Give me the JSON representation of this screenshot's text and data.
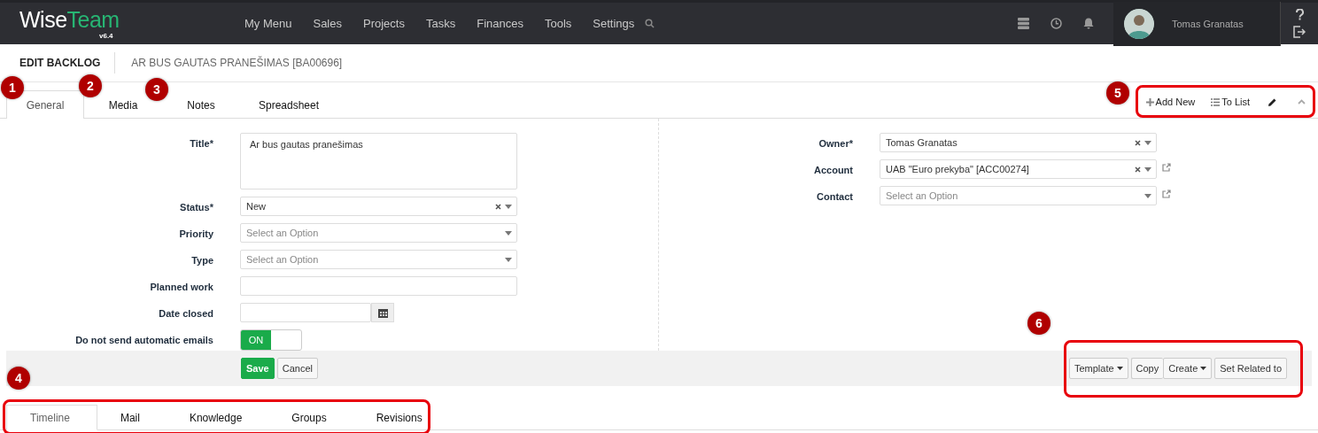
{
  "header": {
    "logo_primary": "Wise",
    "logo_accent": "Team",
    "version": "v6.4",
    "nav": [
      "My Menu",
      "Sales",
      "Projects",
      "Tasks",
      "Finances",
      "Tools",
      "Settings"
    ],
    "user_name": "Tomas Granatas"
  },
  "page": {
    "title": "EDIT BACKLOG",
    "record": "AR BUS GAUTAS PRANEŠIMAS [BA00696]"
  },
  "tabs": [
    {
      "label": "General",
      "selected": true
    },
    {
      "label": "Media",
      "selected": false
    },
    {
      "label": "Notes",
      "selected": false
    },
    {
      "label": "Spreadsheet",
      "selected": false
    }
  ],
  "toolbar": {
    "add_new": "Add New",
    "to_list": "To List"
  },
  "left_fields": [
    {
      "label": "Title*",
      "kind": "textarea",
      "value": "Ar bus gautas pranešimas"
    },
    {
      "label": "Status*",
      "kind": "select",
      "value": "New",
      "clearable": true
    },
    {
      "label": "Priority",
      "kind": "select",
      "placeholder": "Select an Option",
      "clearable": false
    },
    {
      "label": "Type",
      "kind": "select",
      "placeholder": "Select an Option",
      "clearable": false
    },
    {
      "label": "Planned work",
      "kind": "text"
    },
    {
      "label": "Date closed",
      "kind": "date"
    },
    {
      "label": "Do not send automatic emails",
      "kind": "toggle",
      "on": true,
      "value": "ON"
    }
  ],
  "right_fields": [
    {
      "label": "Owner*",
      "kind": "select",
      "value": "Tomas Granatas",
      "clearable": true,
      "link": false
    },
    {
      "label": "Account",
      "kind": "select",
      "value": "UAB \"Euro prekyba\" [ACC00274]",
      "clearable": true,
      "link": true
    },
    {
      "label": "Contact",
      "kind": "select",
      "placeholder": "Select an Option",
      "clearable": false,
      "link": true
    }
  ],
  "form_buttons": [
    {
      "label": "Save",
      "kind": "primary"
    },
    {
      "label": "Cancel",
      "kind": "default"
    }
  ],
  "action_buttons": [
    {
      "label": "Template",
      "caret": true
    },
    {
      "label": "Copy",
      "caret": false
    },
    {
      "label": "Create",
      "caret": true
    },
    {
      "label": "Set Related to",
      "caret": false
    }
  ],
  "bottom_tabs": [
    {
      "label": "Timeline",
      "selected": true
    },
    {
      "label": "Mail",
      "selected": false
    },
    {
      "label": "Knowledge",
      "selected": false
    },
    {
      "label": "Groups",
      "selected": false
    },
    {
      "label": "Revisions",
      "selected": false
    }
  ],
  "callouts": [
    "1",
    "2",
    "3",
    "4",
    "5",
    "6"
  ]
}
